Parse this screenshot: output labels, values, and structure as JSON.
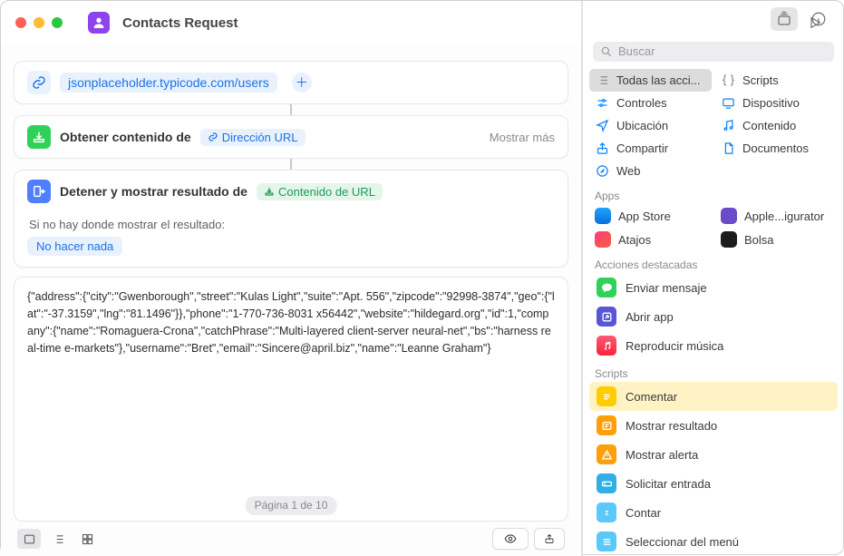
{
  "header": {
    "title": "Contacts Request"
  },
  "workflow": {
    "url": "jsonplaceholder.typicode.com/users",
    "step_get": {
      "label": "Obtener contenido de",
      "var": "Dirección URL",
      "more": "Mostrar más"
    },
    "step_stop": {
      "label": "Detener y mostrar resultado de",
      "var": "Contenido de URL"
    },
    "noresult_label": "Si no hay donde mostrar el resultado:",
    "nothing_chip": "No hacer nada",
    "result_text": "{\"address\":{\"city\":\"Gwenborough\",\"street\":\"Kulas Light\",\"suite\":\"Apt. 556\",\"zipcode\":\"92998-3874\",\"geo\":{\"lat\":\"-37.3159\",\"lng\":\"81.1496\"}},\"phone\":\"1-770-736-8031 x56442\",\"website\":\"hildegard.org\",\"id\":1,\"company\":{\"name\":\"Romaguera-Crona\",\"catchPhrase\":\"Multi-layered client-server neural-net\",\"bs\":\"harness real-time e-markets\"},\"username\":\"Bret\",\"email\":\"Sincere@april.biz\",\"name\":\"Leanne Graham\"}",
    "page_info": "Página 1 de 10"
  },
  "sidebar": {
    "search_placeholder": "Buscar",
    "categories": {
      "all": "Todas las acci...",
      "scripts": "Scripts",
      "controls": "Controles",
      "device": "Dispositivo",
      "location": "Ubicación",
      "content": "Contenido",
      "share": "Compartir",
      "documents": "Documentos",
      "web": "Web"
    },
    "sections": {
      "apps": "Apps",
      "featured": "Acciones destacadas",
      "scripts": "Scripts"
    },
    "apps": {
      "appstore": "App Store",
      "configurator": "Apple...igurator",
      "shortcuts": "Atajos",
      "stocks": "Bolsa"
    },
    "featured_actions": {
      "send": "Enviar mensaje",
      "open": "Abrir app",
      "play": "Reproducir música"
    },
    "script_actions": {
      "comment": "Comentar",
      "show_result": "Mostrar resultado",
      "show_alert": "Mostrar alerta",
      "ask_input": "Solicitar entrada",
      "count": "Contar",
      "menu_select": "Seleccionar del menú"
    }
  }
}
